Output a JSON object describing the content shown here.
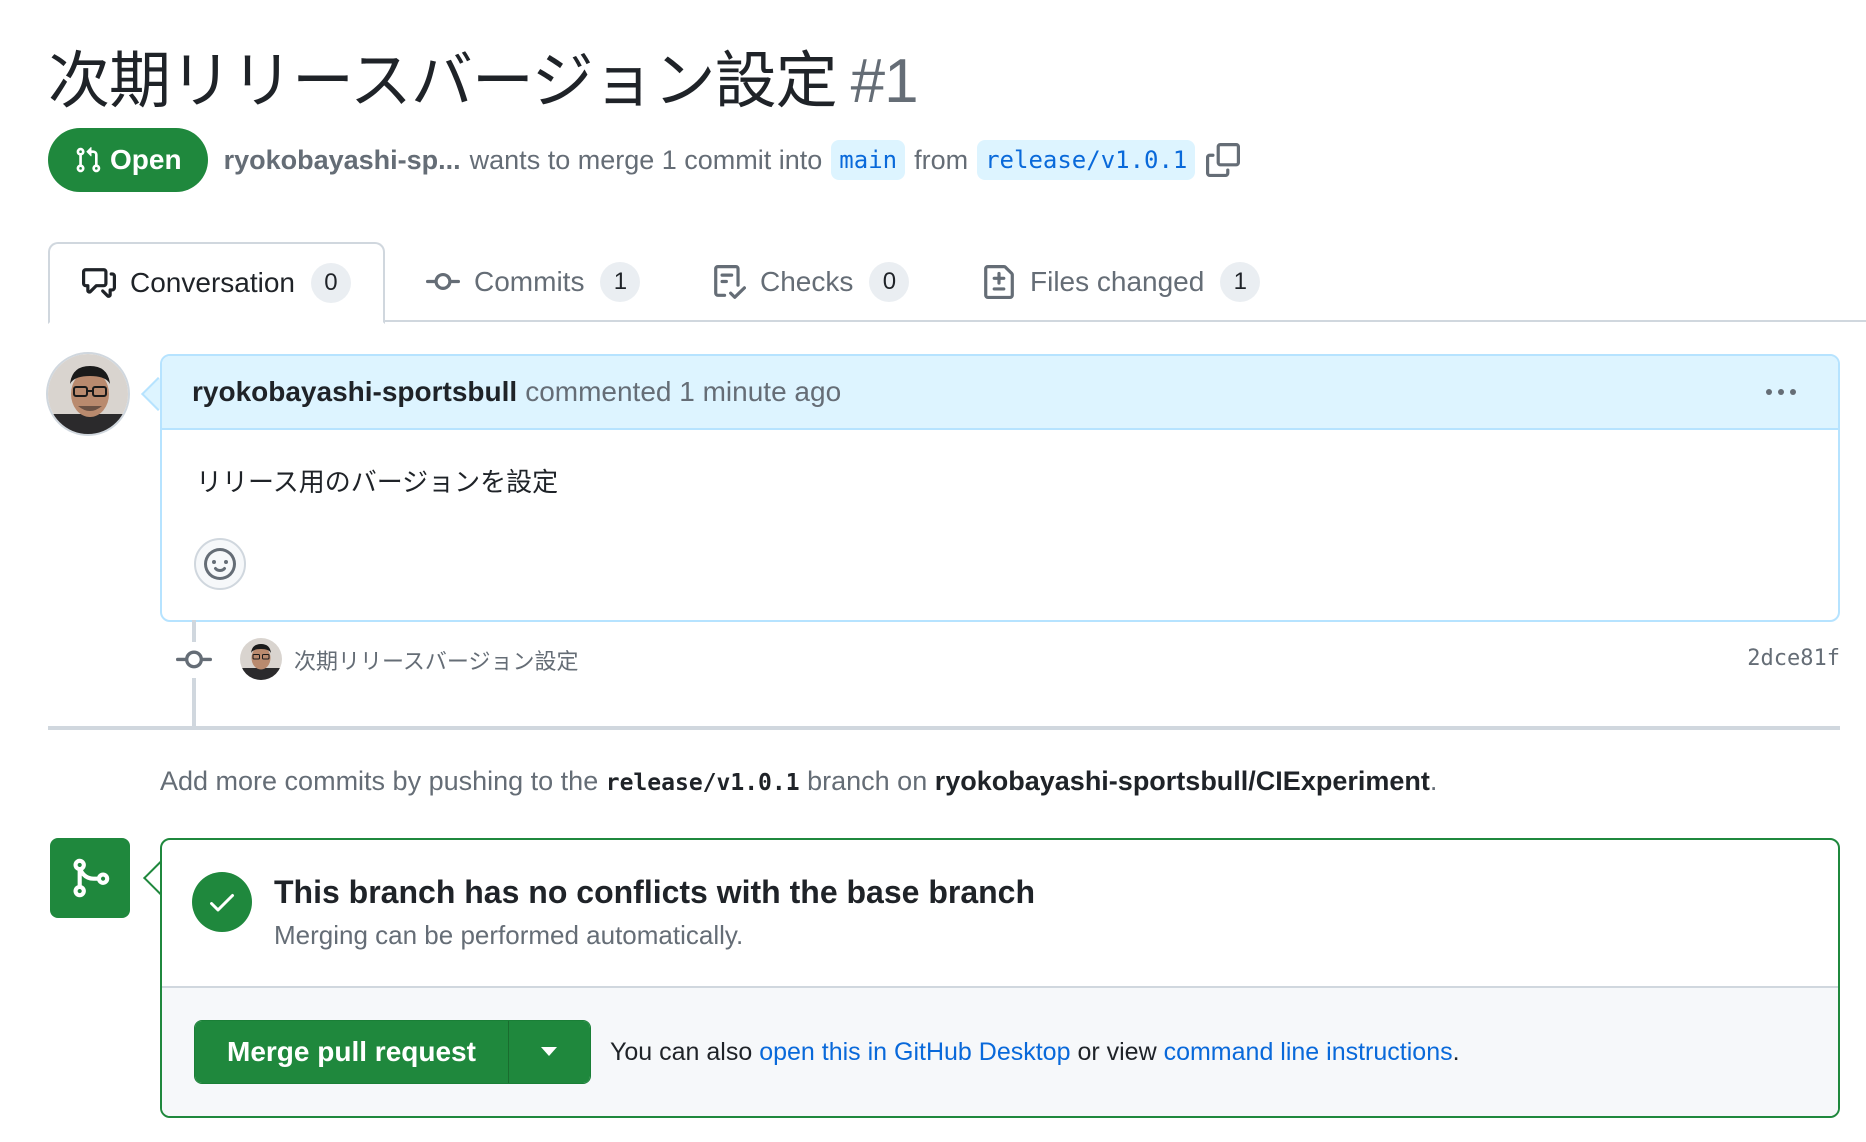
{
  "title": {
    "text": "次期リリースバージョン設定",
    "number": "#1"
  },
  "header": {
    "state": "Open",
    "author": "ryokobayashi-sp...",
    "action_text": "wants to merge 1 commit into",
    "base_branch": "main",
    "from_text": "from",
    "head_branch": "release/v1.0.1"
  },
  "tabs": [
    {
      "label": "Conversation",
      "count": "0",
      "icon": "comment-discussion-icon",
      "active": true
    },
    {
      "label": "Commits",
      "count": "1",
      "icon": "git-commit-icon"
    },
    {
      "label": "Checks",
      "count": "0",
      "icon": "checklist-icon"
    },
    {
      "label": "Files changed",
      "count": "1",
      "icon": "file-diff-icon"
    }
  ],
  "comment": {
    "author": "ryokobayashi-sportsbull",
    "meta": "commented 1 minute ago",
    "body": "リリース用のバージョンを設定"
  },
  "commit": {
    "message": "次期リリースバージョン設定",
    "sha": "2dce81f"
  },
  "push_hint": {
    "prefix": "Add more commits by pushing to the",
    "branch": "release/v1.0.1",
    "middle": "branch on",
    "repo": "ryokobayashi-sportsbull/CIExperiment",
    "suffix": "."
  },
  "merge": {
    "heading": "This branch has no conflicts with the base branch",
    "subtext": "Merging can be performed automatically.",
    "button_label": "Merge pull request",
    "alt_prefix": "You can also",
    "alt_link1": "open this in GitHub Desktop",
    "alt_middle": "or view",
    "alt_link2": "command line instructions",
    "alt_suffix": "."
  },
  "colors": {
    "open_green": "#1f883d",
    "link_blue": "#0969da",
    "comment_header_bg": "#ddf4ff",
    "muted_text": "#656d76"
  }
}
